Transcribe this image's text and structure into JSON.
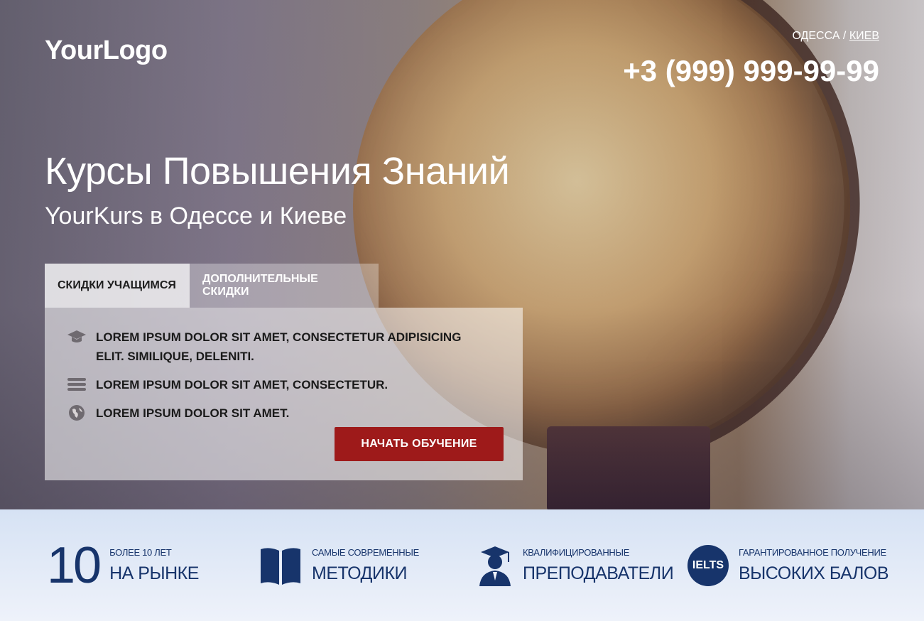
{
  "header": {
    "logo": "YourLogo",
    "city_current": "ОДЕССА",
    "city_separator": " / ",
    "city_link": "КИЕВ",
    "phone": "+3 (999) 999-99-99"
  },
  "hero": {
    "title": "Курсы Повышения Знаний",
    "subtitle": "YourKurs в Одессе и Киеве"
  },
  "tabs": [
    {
      "label": "СКИДКИ УЧАЩИМСЯ",
      "active": true
    },
    {
      "label": "ДОПОЛНИТЕЛЬНЫЕ СКИДКИ",
      "active": false
    }
  ],
  "panel": {
    "items": [
      {
        "icon": "graduation-cap-icon",
        "text": "LOREM IPSUM DOLOR SIT AMET, CONSECTETUR ADIPISICING ELIT. SIMILIQUE, DELENITI."
      },
      {
        "icon": "list-bars-icon",
        "text": "LOREM IPSUM DOLOR SIT AMET, CONSECTETUR."
      },
      {
        "icon": "globe-icon",
        "text": "LOREM IPSUM DOLOR SIT AMET."
      }
    ],
    "cta_label": "НАЧАТЬ ОБУЧЕНИЕ"
  },
  "features": [
    {
      "big": "10",
      "small": "БОЛЕЕ 10 ЛЕТ",
      "main": "НА РЫНКЕ"
    },
    {
      "icon": "open-book-icon",
      "small": "САМЫЕ СОВРЕМЕННЫЕ",
      "main": "МЕТОДИКИ"
    },
    {
      "icon": "teacher-icon",
      "small": "КВАЛИФИЦИРОВАННЫЕ",
      "main": "ПРЕПОДАВАТЕЛИ"
    },
    {
      "badge": "IELTS",
      "small": "ГАРАНТИРОВАННОЕ ПОЛУЧЕНИЕ",
      "main": "ВЫСОКИХ БАЛОВ"
    }
  ],
  "colors": {
    "accent_red": "#9e1a1a",
    "navy": "#17346b"
  }
}
